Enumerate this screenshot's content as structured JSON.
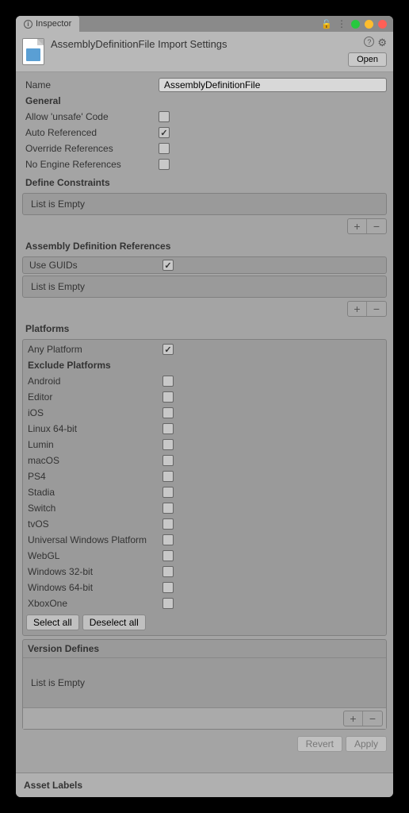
{
  "tab": {
    "label": "Inspector"
  },
  "header": {
    "title": "AssemblyDefinitionFile Import Settings",
    "open_btn": "Open"
  },
  "name_field": {
    "label": "Name",
    "value": "AssemblyDefinitionFile"
  },
  "general": {
    "title": "General",
    "allow_unsafe": {
      "label": "Allow 'unsafe' Code",
      "checked": false
    },
    "auto_referenced": {
      "label": "Auto Referenced",
      "checked": true
    },
    "override_refs": {
      "label": "Override References",
      "checked": false
    },
    "no_engine": {
      "label": "No Engine References",
      "checked": false
    }
  },
  "define_constraints": {
    "title": "Define Constraints",
    "empty": "List is Empty"
  },
  "assembly_refs": {
    "title": "Assembly Definition References",
    "use_guids": {
      "label": "Use GUIDs",
      "checked": true
    },
    "empty": "List is Empty"
  },
  "platforms": {
    "title": "Platforms",
    "any": {
      "label": "Any Platform",
      "checked": true
    },
    "exclude_title": "Exclude Platforms",
    "items": [
      {
        "label": "Android",
        "checked": false
      },
      {
        "label": "Editor",
        "checked": false
      },
      {
        "label": "iOS",
        "checked": false
      },
      {
        "label": "Linux 64-bit",
        "checked": false
      },
      {
        "label": "Lumin",
        "checked": false
      },
      {
        "label": "macOS",
        "checked": false
      },
      {
        "label": "PS4",
        "checked": false
      },
      {
        "label": "Stadia",
        "checked": false
      },
      {
        "label": "Switch",
        "checked": false
      },
      {
        "label": "tvOS",
        "checked": false
      },
      {
        "label": "Universal Windows Platform",
        "checked": false
      },
      {
        "label": "WebGL",
        "checked": false
      },
      {
        "label": "Windows 32-bit",
        "checked": false
      },
      {
        "label": "Windows 64-bit",
        "checked": false
      },
      {
        "label": "XboxOne",
        "checked": false
      }
    ],
    "select_all": "Select all",
    "deselect_all": "Deselect all"
  },
  "version_defines": {
    "title": "Version Defines",
    "empty": "List is Empty"
  },
  "buttons": {
    "revert": "Revert",
    "apply": "Apply"
  },
  "asset_labels": "Asset Labels"
}
